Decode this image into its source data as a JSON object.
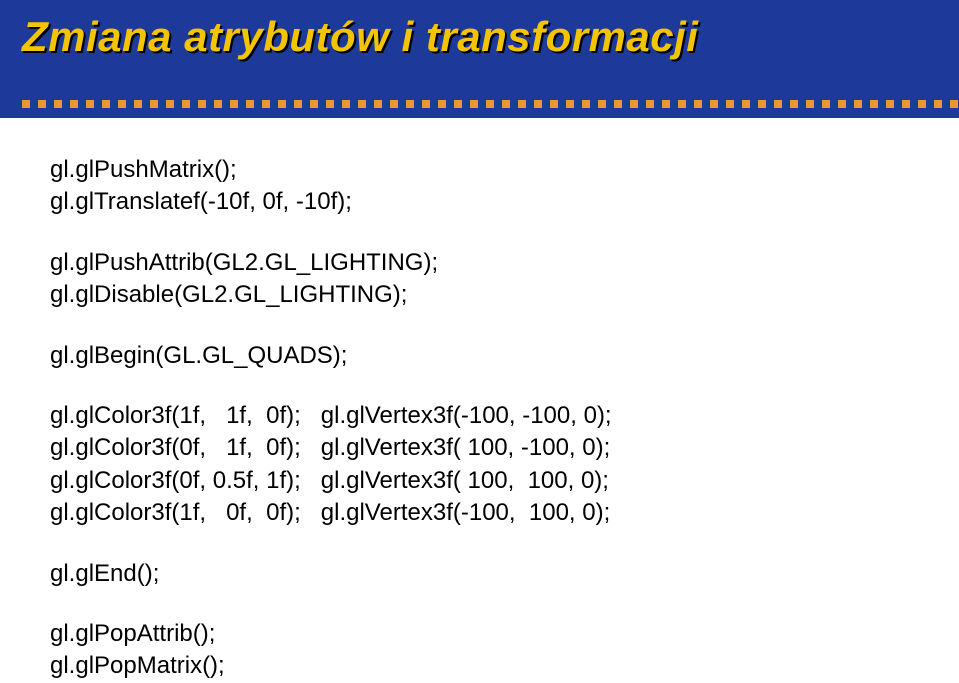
{
  "slide": {
    "title": "Zmiana atrybutów i transformacji"
  },
  "code": {
    "push": [
      "gl.glPushMatrix();",
      "gl.glTranslatef(-10f, 0f, -10f);"
    ],
    "attrib": [
      "gl.glPushAttrib(GL2.GL_LIGHTING);",
      "gl.glDisable(GL2.GL_LIGHTING);"
    ],
    "begin": "gl.glBegin(GL.GL_QUADS);",
    "verts": [
      "gl.glColor3f(1f,   1f,  0f);   gl.glVertex3f(-100, -100, 0);",
      "gl.glColor3f(0f,   1f,  0f);   gl.glVertex3f( 100, -100, 0);",
      "gl.glColor3f(0f, 0.5f, 1f);   gl.glVertex3f( 100,  100, 0);",
      "gl.glColor3f(1f,   0f,  0f);   gl.glVertex3f(-100,  100, 0);"
    ],
    "end": "gl.glEnd();",
    "pop": [
      "gl.glPopAttrib();",
      "gl.glPopMatrix();"
    ]
  }
}
